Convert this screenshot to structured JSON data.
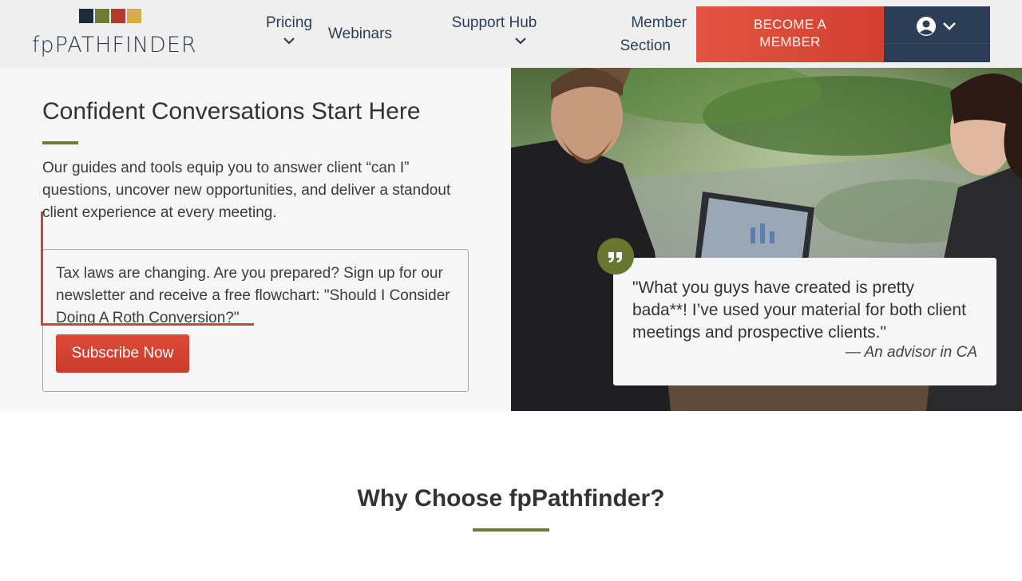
{
  "brand": {
    "logo_text": "fpPATHFINDER",
    "logo_colors": [
      "#1b2a3a",
      "#6b7d35",
      "#b33a2f",
      "#d7ad4b"
    ]
  },
  "nav": {
    "pricing": "Pricing",
    "webinars": "Webinars",
    "support_hub": "Support Hub",
    "member_section_line1": "Member",
    "member_section_line2": "Section",
    "become_member_line1": "BECOME A",
    "become_member_line2": "MEMBER",
    "account_icon": "user-circle-icon"
  },
  "hero": {
    "title": "Confident Conversations Start Here",
    "body": "Our guides and tools equip you to answer client “can I” questions, uncover new opportunities, and deliver a standout client experience at every meeting."
  },
  "signup": {
    "text": "Tax laws are changing. Are you prepared? Sign up for our newsletter and receive a free flowchart: \"Should I Consider Doing A Roth Conversion?\"",
    "button": "Subscribe Now"
  },
  "testimonial": {
    "quote": "\"What you guys have created is pretty bada**! I’ve used your material for both client meetings and prospective clients.\"",
    "attribution": "— An advisor in CA",
    "badge_icon": "quote-icon"
  },
  "why": {
    "title": "Why Choose fpPathfinder?"
  },
  "colors": {
    "accent_green": "#6b7d35",
    "accent_red": "#dd4b39",
    "navy": "#2c3e55"
  }
}
